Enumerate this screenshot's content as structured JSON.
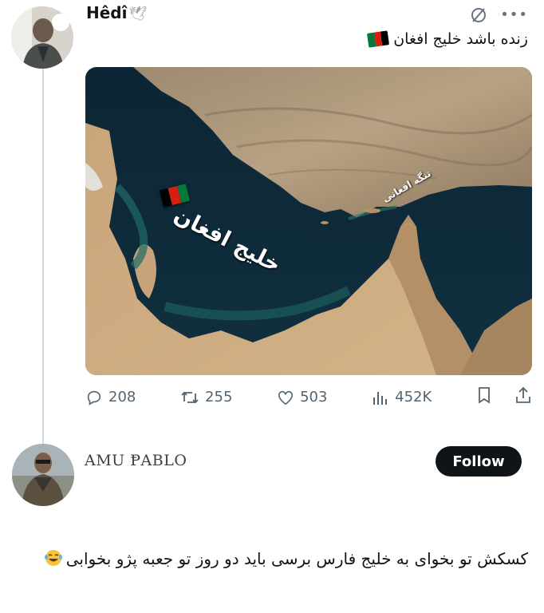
{
  "tweet": {
    "author": "Hêdî",
    "author_emoji": "🕊",
    "text": "زنده باشد خلیج افغان",
    "map": {
      "main_label": "خلیج افغان",
      "strait_label": "تنگه افغانی"
    },
    "stats": {
      "replies": "208",
      "retweets": "255",
      "likes": "503",
      "views": "452K"
    }
  },
  "reply": {
    "author": "AMU ⱣABLO",
    "follow_label": "Follow",
    "text": "کسکش تو بخوای به خلیج فارس برسی باید دو روز تو جعبه پژو بخوابی",
    "emoji": "😂"
  },
  "colors": {
    "flag_black": "#000000",
    "flag_red": "#d32011",
    "flag_green": "#007a36",
    "sea": "#0e2a3a",
    "land": "#b59a77",
    "follow_bg": "#0f1419",
    "icon_gray": "#536471"
  }
}
